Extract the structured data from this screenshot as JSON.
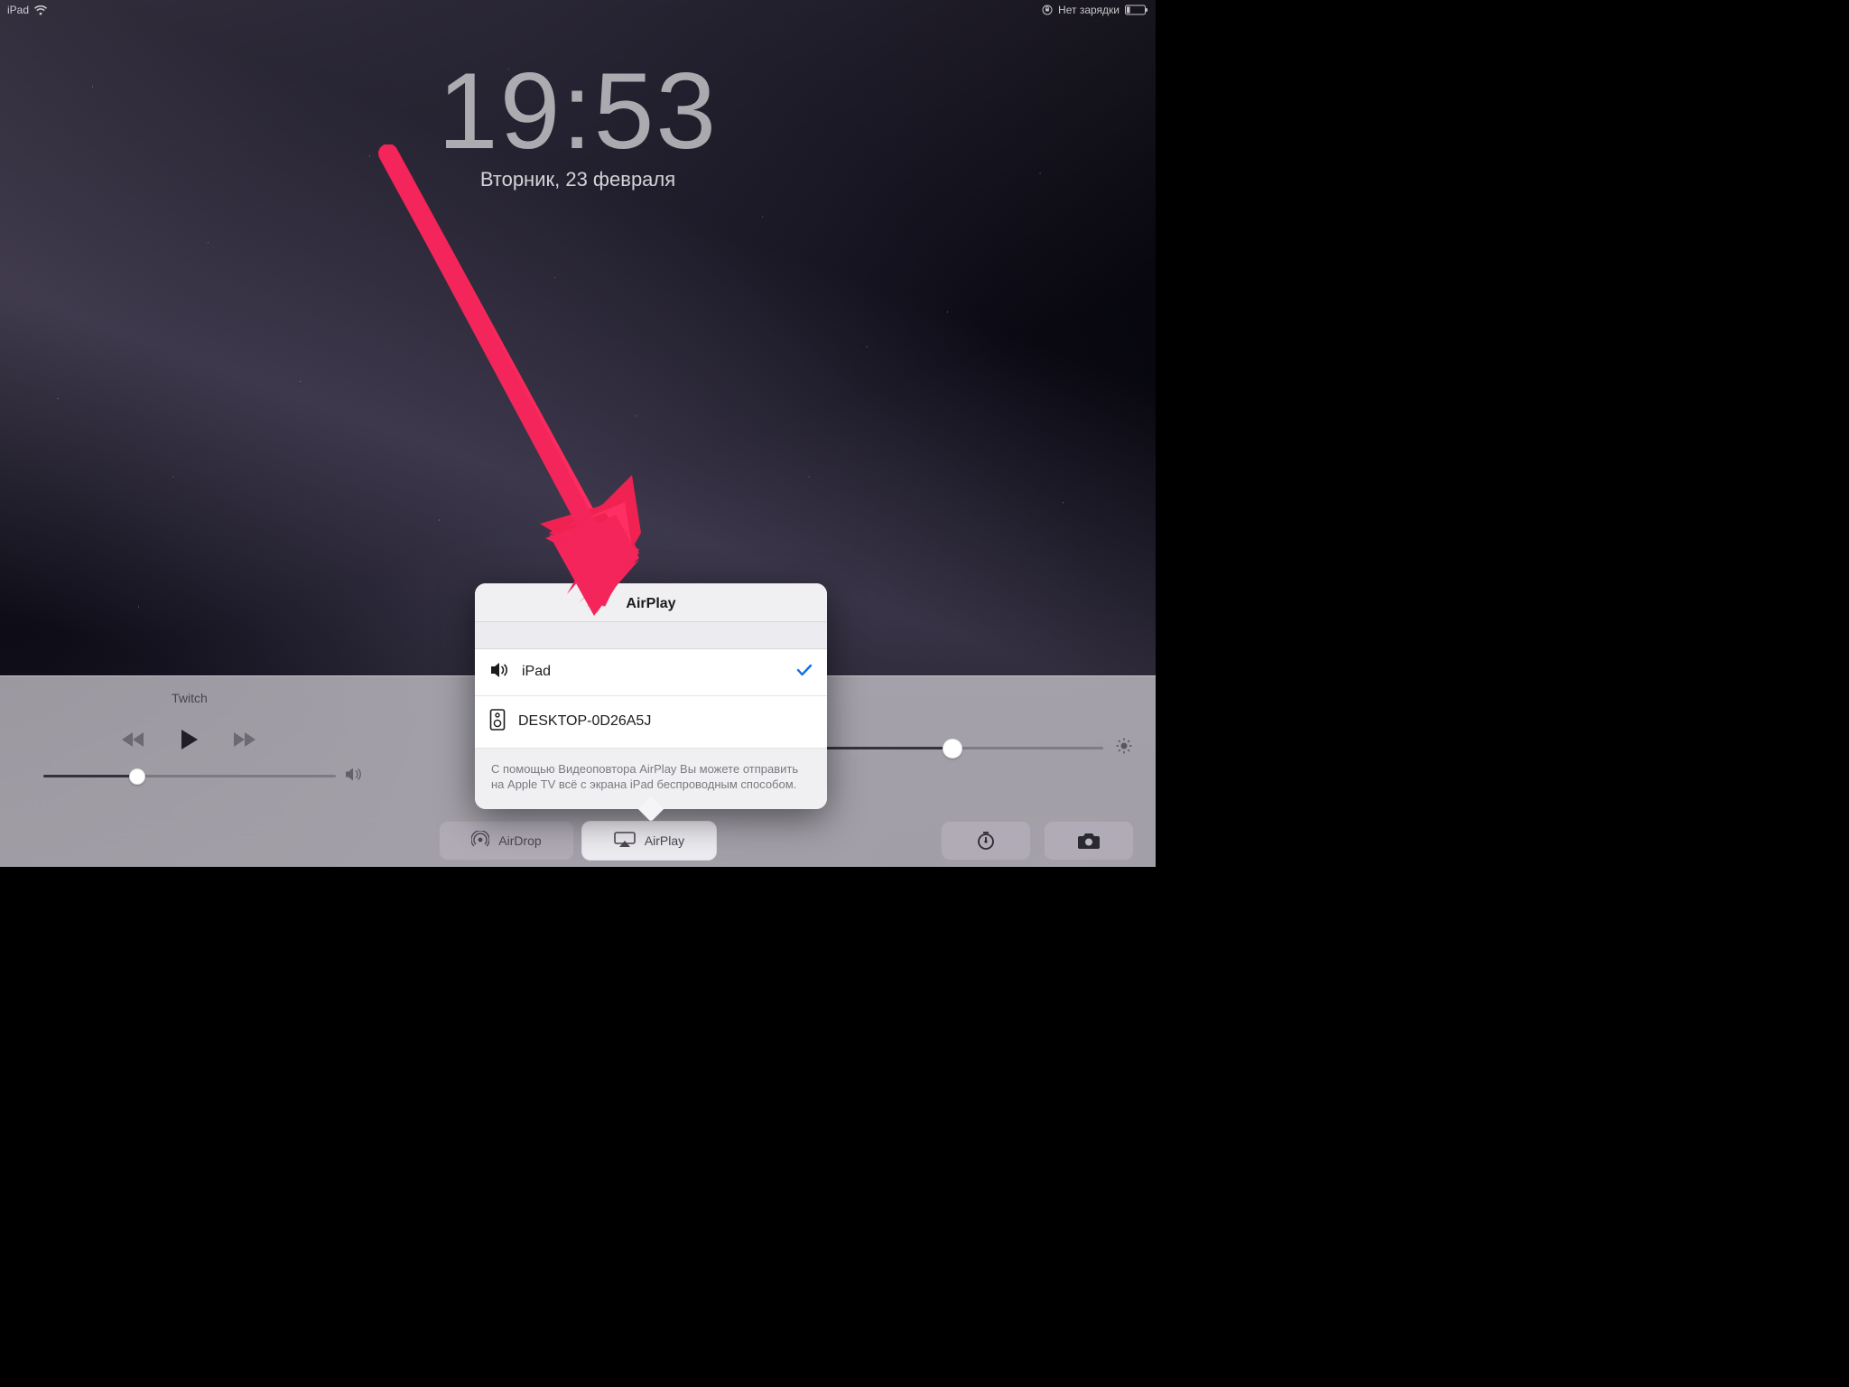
{
  "status_bar": {
    "device": "iPad",
    "battery_text": "Нет зарядки"
  },
  "lock_screen": {
    "time": "19:53",
    "date": "Вторник, 23 февраля"
  },
  "control_center": {
    "now_playing_title": "Twitch",
    "airdrop_label": "AirDrop",
    "airplay_label": "AirPlay"
  },
  "airplay_popover": {
    "title": "AirPlay",
    "devices": [
      {
        "name": "iPad",
        "selected": true,
        "type": "speaker"
      },
      {
        "name": "DESKTOP-0D26A5J",
        "selected": false,
        "type": "display"
      }
    ],
    "footer": "С помощью Видеоповтора AirPlay Вы можете отправить на Apple TV всё с экрана iPad беспроводным способом."
  },
  "annotation": {
    "arrow_color": "#f02252"
  }
}
